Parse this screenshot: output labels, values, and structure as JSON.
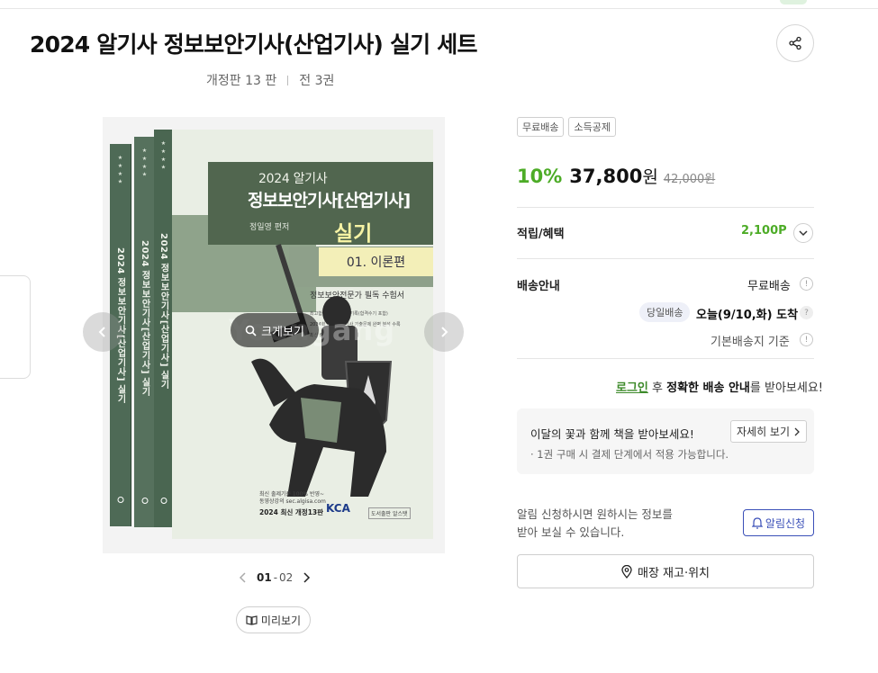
{
  "product": {
    "title": "2024 알기사 정보보안기사(산업기사) 실기 세트",
    "edition": "개정판 13 판",
    "volumes": "전 3권"
  },
  "cover": {
    "series_top": "2024 알기사",
    "main_title": "정보보안기사[산업기사]",
    "author": "정일영 편저",
    "subtitle": "실기",
    "part": "01. 이론편",
    "tagline": "정보보안전문가 필독 수험서",
    "desc_line1": "최고합격률과 적중률 기록(합격수기 포함)",
    "desc_line2": "2024회 기사/산업기사 기출문제 완벽 분석 수록",
    "desc_line3": "최신 출제 경향, 기출 문제",
    "foot_line1": "최신 출제기준 100% 반영~",
    "foot_line2": "동영상강의 sec.algisa.com",
    "edition_line": "2024 최신 개정13판",
    "kca": "KCA",
    "publisher": "도서출판 알스탯",
    "spine_text_1": "2024 정보보안기사[산업기사] 실기",
    "spine_text_2": "2024 정보보안기사[산업기사] 실기",
    "spine_text_3": "2024 정보보안기사[산업기사] 실기",
    "zoom_label": "크게보기",
    "watermark": "Yoongang"
  },
  "gallery": {
    "current": "01",
    "separator": "-",
    "total": "02",
    "preview_label": "미리보기"
  },
  "badges": [
    "무료배송",
    "소득공제"
  ],
  "price": {
    "discount": "10%",
    "sale": "37,800",
    "won": "원",
    "original": "42,000원"
  },
  "benefits": {
    "label": "적립/혜택",
    "points": "2,100P"
  },
  "shipping": {
    "label": "배송안내",
    "free": "무료배송",
    "same_day_badge": "당일배송",
    "arrival": "오늘(9/10,화) 도착",
    "default_addr": "기본배송지 기준"
  },
  "login_notice": {
    "link": "로그인",
    "after_link": " 후 ",
    "bold": "정확한 배송 안내",
    "tail": "를 받아보세요!"
  },
  "promo": {
    "title": "이달의 꽃과 함께 책을 받아보세요!",
    "detail_btn": "자세히 보기",
    "note": "· 1권 구매 시 결제 단계에서 적용 가능합니다."
  },
  "alarm": {
    "line1": "알림 신청하시면 원하시는 정보를",
    "line2": "받아 보실 수 있습니다.",
    "button": "알림신청"
  },
  "store": {
    "button": "매장 재고·위치"
  },
  "colors": {
    "accent_green": "#4dac27",
    "alarm_blue": "#3a4fb8",
    "cover_green": "#51664f"
  }
}
